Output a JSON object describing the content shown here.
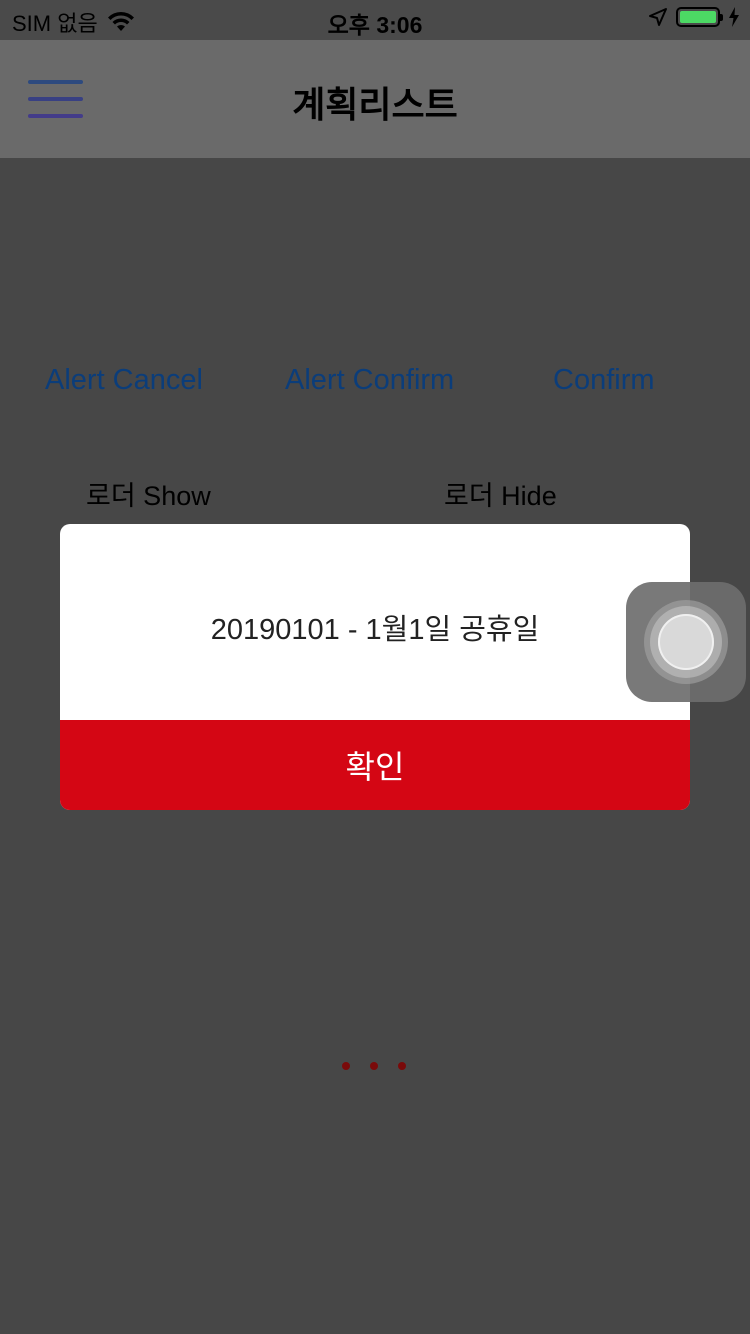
{
  "status_bar": {
    "carrier": "SIM 없음",
    "time": "오후 3:06",
    "icons": [
      "wifi-icon",
      "location-arrow-icon",
      "battery-icon",
      "charging-bolt-icon"
    ]
  },
  "nav": {
    "title": "계획리스트",
    "menu_icon": "hamburger-menu-icon"
  },
  "actions": {
    "alert_cancel": "Alert Cancel",
    "alert_confirm": "Alert Confirm",
    "confirm": "Confirm",
    "loader_show": "로더 Show",
    "loader_hide": "로더 Hide"
  },
  "dialog": {
    "message": "20190101 - 1월1일 공휴일",
    "ok_label": "확인"
  },
  "colors": {
    "accent_red": "#d40614",
    "link_blue": "#0b3d7a",
    "battery_green": "#4cd964",
    "overlay": "#474747"
  }
}
